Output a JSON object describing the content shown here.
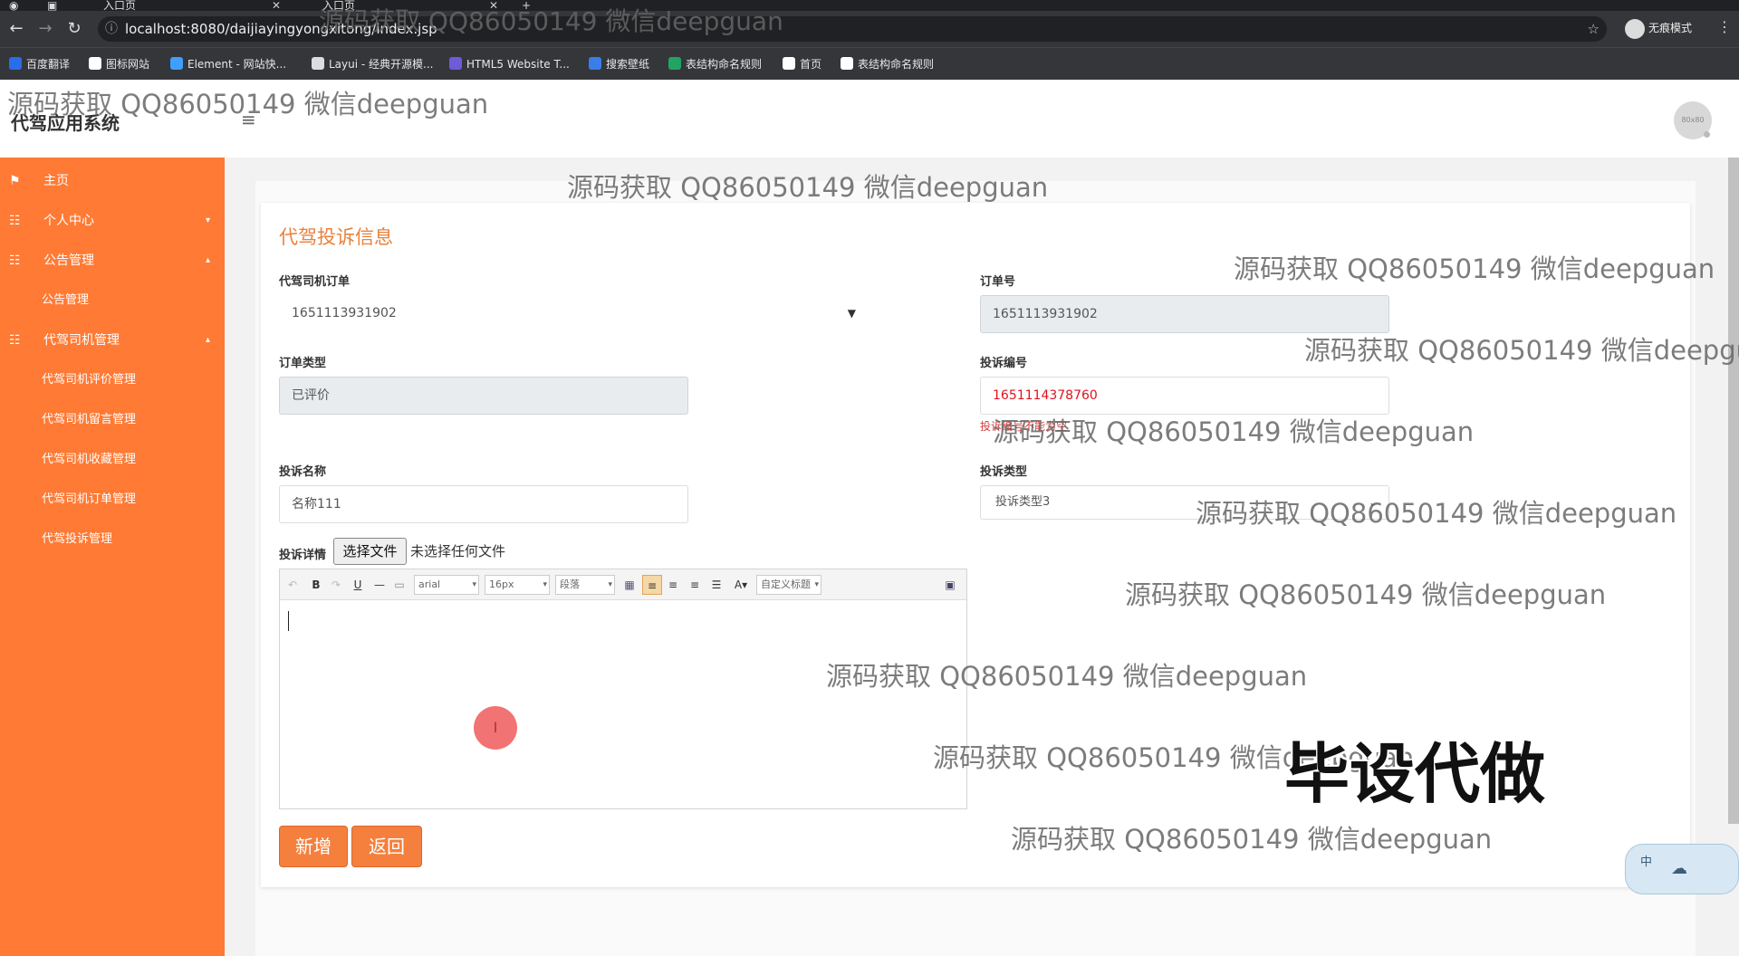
{
  "browser": {
    "tabs": [
      {
        "label": "入口页"
      },
      {
        "label": "入口页"
      }
    ],
    "new_tab": "+",
    "url": "localhost:8080/daijiayingyongxitong/index.jsp",
    "incognito_label": "无痕模式",
    "bookmarks": [
      {
        "label": "百度翻译",
        "color": "#2b6de8"
      },
      {
        "label": "图标网站",
        "color": "#ffffff"
      },
      {
        "label": "Element - 网站快...",
        "color": "#409eff"
      },
      {
        "label": "Layui - 经典开源模...",
        "color": "#dddddd"
      },
      {
        "label": "HTML5 Website T...",
        "color": "#6f5ad8"
      },
      {
        "label": "搜索壁纸",
        "color": "#3b7de9"
      },
      {
        "label": "表结构命名规则",
        "color": "#21a366"
      },
      {
        "label": "首页",
        "color": "#ffffff"
      },
      {
        "label": "表结构命名规则",
        "color": "#ffffff"
      }
    ]
  },
  "app": {
    "title": "代驾应用系统",
    "avatar_text": "80x80"
  },
  "sidebar": {
    "items": [
      {
        "label": "主页",
        "icon": "flag-icon",
        "glyph": "⚑",
        "type": "item"
      },
      {
        "label": "个人中心",
        "icon": "grid-icon",
        "glyph": "☷",
        "type": "group",
        "caret": "▾"
      },
      {
        "label": "公告管理",
        "icon": "grid-icon",
        "glyph": "☷",
        "type": "group",
        "caret": "▴"
      },
      {
        "label": "公告管理",
        "type": "sub"
      },
      {
        "label": "代驾司机管理",
        "icon": "grid-icon",
        "glyph": "☷",
        "type": "group",
        "caret": "▴"
      },
      {
        "label": "代驾司机评价管理",
        "type": "sub"
      },
      {
        "label": "代驾司机留言管理",
        "type": "sub"
      },
      {
        "label": "代驾司机收藏管理",
        "type": "sub"
      },
      {
        "label": "代驾司机订单管理",
        "type": "sub"
      },
      {
        "label": "代驾投诉管理",
        "type": "sub"
      }
    ]
  },
  "form": {
    "title": "代驾投诉信息",
    "driver_order_label": "代驾司机订单",
    "driver_order_value": "1651113931902",
    "order_no_label": "订单号",
    "order_no_value": "1651113931902",
    "order_type_label": "订单类型",
    "order_type_value": "已评价",
    "complaint_no_label": "投诉编号",
    "complaint_no_value": "1651114378760",
    "complaint_no_error": "投诉编号不能为空",
    "complaint_name_label": "投诉名称",
    "complaint_name_value": "名称111",
    "complaint_type_label": "投诉类型",
    "complaint_type_value": "投诉类型3",
    "detail_label": "投诉详情",
    "file_button": "选择文件",
    "file_status": "未选择任何文件",
    "editor": {
      "font": "arial",
      "size": "16px",
      "paragraph": "段落",
      "custom_title": "自定义标题",
      "font_color": "A"
    },
    "add_button": "新增",
    "back_button": "返回"
  },
  "overlay": {
    "watermark": "源码获取 QQ86050149 微信deepguan",
    "big_text": "毕设代做",
    "ime_label": "中"
  }
}
